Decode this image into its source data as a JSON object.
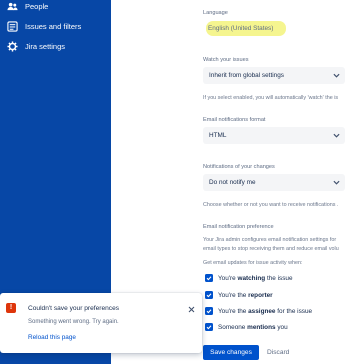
{
  "sidebar": {
    "items": [
      {
        "label": "People",
        "icon": "people-icon"
      },
      {
        "label": "Issues and filters",
        "icon": "issues-filters-icon"
      },
      {
        "label": "Jira settings",
        "icon": "gear-icon"
      }
    ]
  },
  "settings": {
    "language": {
      "label": "Language",
      "value": "English (United States)"
    },
    "watch": {
      "label": "Watch your issues",
      "value": "Inherit from global settings",
      "hint": "If you select enabled, you will automatically 'watch' the is"
    },
    "email_format": {
      "label": "Email notifications format",
      "value": "HTML"
    },
    "own_changes": {
      "label": "Notifications of your changes",
      "value": "Do not notify me",
      "hint": "Choose whether or not you want to receive notifications ."
    },
    "email_pref": {
      "label": "Email notification preference",
      "desc_1": "Your Jira admin configures email notification settings for",
      "desc_2": "email types to stop receiving them and reduce email volu",
      "desc_3": "Get email updates for issue activity when:",
      "options": [
        {
          "pre": "You're ",
          "bold": "watching",
          "post": " the issue"
        },
        {
          "pre": "You're the ",
          "bold": "reporter",
          "post": ""
        },
        {
          "pre": "You're the ",
          "bold": "assignee",
          "post": " for the issue"
        },
        {
          "pre": "Someone ",
          "bold": "mentions",
          "post": " you"
        }
      ]
    }
  },
  "actions": {
    "save": "Save changes",
    "discard": "Discard"
  },
  "toast": {
    "title": "Couldn't save your preferences",
    "message": "Something went wrong. Try again.",
    "link": "Reload this page",
    "error_icon_glyph": "!"
  },
  "colors": {
    "sidebar": "#0747a6",
    "primary": "#0052cc",
    "error": "#de350b",
    "highlight": "#f1f16a"
  }
}
